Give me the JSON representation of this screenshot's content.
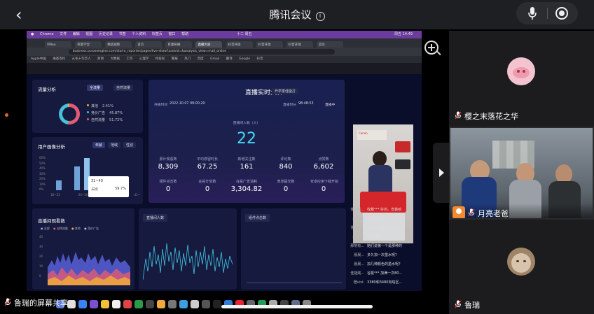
{
  "meeting": {
    "title": "腾讯会议",
    "info_icon": "info-icon"
  },
  "share": {
    "presenter_label": "鲁瑞的屏幕共享",
    "mac_menu": [
      "Chrome",
      "文件",
      "编辑",
      "视图",
      "历史记录",
      "书签",
      "个人资料",
      "标签页",
      "窗口",
      "帮助"
    ],
    "mac_status_time": "十二 周五",
    "mac_clock": "周五 14:49",
    "tabs": [
      "VMeo",
      "巨量学堂",
      "精选视频",
      "首页",
      "巨量纵横",
      "直播大屏",
      "抖音开放",
      "抖音开放",
      "抖音开放",
      "首页"
    ],
    "url": "business.oceanengine.com/storm_reporter/pages/live-show?aadvid=&analysis_view=mall_online",
    "bookmarks": [
      "Apple中国",
      "维基百科",
      "从冬十华华人",
      "新闻",
      "大数据",
      "工作",
      "心理学",
      "抢投标",
      "警报",
      "热门",
      "百度",
      "Gmail",
      "翻译",
      "Google",
      "抖音"
    ]
  },
  "dashboard": {
    "traffic": {
      "title": "流量分析",
      "tabs": [
        "全流量",
        "自然流量"
      ],
      "legend": [
        {
          "label": "其他",
          "value": "2.41%",
          "color": "#f2a93b"
        },
        {
          "label": "竞价广告",
          "value": "45.87%",
          "color": "#48c0d8"
        },
        {
          "label": "自然流量",
          "value": "51.72%",
          "color": "#e05b73"
        }
      ]
    },
    "portrait": {
      "title": "用户画像分析",
      "tabs": [
        "年龄",
        "地域",
        "性别"
      ],
      "y_ticks": [
        "60%",
        "50%",
        "40%",
        "30%",
        "20%",
        "10%",
        "0%"
      ],
      "x_ticks": [
        "18~23",
        "24~30",
        "31~40",
        "41~"
      ],
      "tooltip_title": "31~40",
      "tooltip_label": "占比",
      "tooltip_value": "59.7%"
    },
    "live": {
      "title": "直播实时大屏",
      "switch_label": "开学季佳能打",
      "start_time_label": "开播时间",
      "start_time": "2022.10.07 09:00:20",
      "duration_label": "直播时长",
      "duration": "98:48:53",
      "status": "直播中",
      "online_label": "直播间人数（人）",
      "online_value": "22",
      "stats_row1": [
        {
          "label": "累计观看数",
          "value": "8,309"
        },
        {
          "label": "平均停留时长",
          "value": "67.25"
        },
        {
          "label": "新增关注数",
          "value": "161"
        },
        {
          "label": "评论数",
          "value": "840"
        },
        {
          "label": "点赞数",
          "value": "6,602"
        }
      ],
      "stats_row2": [
        {
          "label": "组件点击数",
          "value": "0"
        },
        {
          "label": "在投计划数",
          "value": "0"
        },
        {
          "label": "在投广告消耗",
          "value": "3,304.82"
        },
        {
          "label": "表单提交数",
          "value": "0"
        },
        {
          "label": "安卓应用下载开始",
          "value": "0"
        }
      ]
    },
    "viewers": {
      "title": "直播间观看数",
      "legend": [
        "全部",
        "自然流量",
        "其他",
        "竞价广告"
      ],
      "y_ticks": [
        "40",
        "30",
        "20",
        "10",
        "0"
      ]
    },
    "online_chart": {
      "select": "直播间人数"
    },
    "component_chart": {
      "select": "组件点击数"
    },
    "chat": [
      {
        "user": "佳能威...",
        "text": "收藏*** 好的。安装哈"
      },
      {
        "user": "小左哥:",
        "text": "有针打的么?"
      },
      {
        "user": "佳能威...",
        "text": "谷小*** 那就是最直..."
      },
      {
        "user": "小左哥:",
        "text": "要连供的"
      },
      {
        "user": "那地有...",
        "text": "她们说第一个是那种的"
      },
      {
        "user": "晨晨...",
        "text": "多久加一次墨水呢?"
      },
      {
        "user": "晨晨...",
        "text": "加几种颜色的墨水呢?"
      },
      {
        "user": "佳能威...",
        "text": "谷曼*** 加满一次80..."
      },
      {
        "user": "橙vivi:",
        "text": "3380和3480有啥区..."
      }
    ]
  },
  "participants": [
    {
      "name": "樱之末落花之华",
      "avatar": "pig-avatar-icon"
    },
    {
      "name": "月亮老爸",
      "role": "host",
      "camera": "on"
    },
    {
      "name": "鲁瑞",
      "avatar": "cat-avatar-icon"
    }
  ]
}
